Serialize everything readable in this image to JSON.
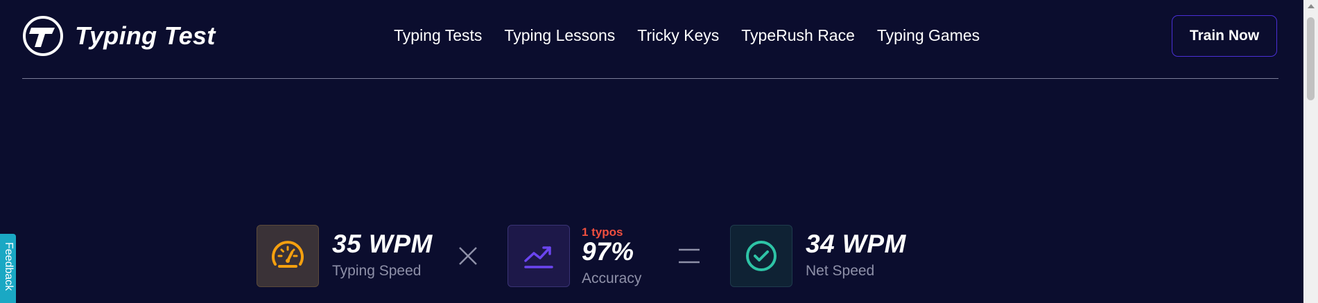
{
  "header": {
    "logo_text": "Typing Test",
    "nav": [
      {
        "label": "Typing Tests"
      },
      {
        "label": "Typing Lessons"
      },
      {
        "label": "Tricky Keys"
      },
      {
        "label": "TypeRush Race"
      },
      {
        "label": "Typing Games"
      }
    ],
    "cta_label": "Train Now"
  },
  "stats": {
    "speed": {
      "value": "35 WPM",
      "label": "Typing Speed",
      "icon": "speedometer-icon"
    },
    "accuracy": {
      "typos": "1 typos",
      "value": "97%",
      "label": "Accuracy",
      "icon": "trend-up-icon"
    },
    "net": {
      "value": "34 WPM",
      "label": "Net Speed",
      "icon": "check-circle-icon"
    }
  },
  "feedback": {
    "label": "Feedback"
  },
  "colors": {
    "background": "#0b0d2e",
    "accent_purple": "#4a2fd6",
    "speed_icon": "#f5a00f",
    "accuracy_icon": "#6b45f0",
    "net_icon": "#2ec4a6",
    "typos": "#ef4f3f",
    "feedback_tab": "#1aa8c4"
  }
}
